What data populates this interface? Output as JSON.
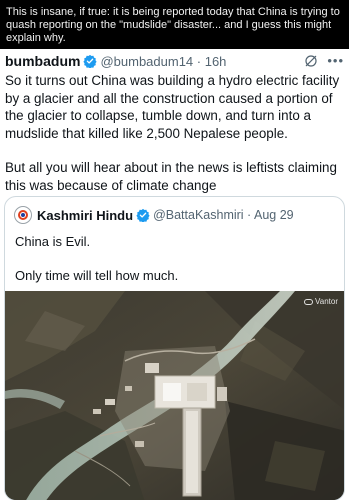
{
  "banner": {
    "text": "This is insane, if true: it is being reported today that China is trying to quash reporting on the \"mudslide\" disaster... and I guess this might explain why."
  },
  "tweet": {
    "author_name": "bumbadum",
    "author_handle": "@bumbadum14",
    "time": "16h",
    "paragraph1": "So it turns out China was building a hydro electric facility by a glacier and all the construction caused a portion of the glacier to collapse, tumble down, and turn into a mudslide that killed like 2,500 Nepalese people.",
    "paragraph2": "But all you will hear about in the news is leftists claiming this was because of climate change",
    "icons": {
      "verified": "verified-badge-icon",
      "grok": "grok-icon",
      "more": "more-icon"
    }
  },
  "quoted": {
    "author_name": "Kashmiri Hindu",
    "author_handle": "@BattaKashmiri",
    "date": "Aug 29",
    "line1": "China is Evil.",
    "line2": "Only time will tell how much.",
    "image_watermark": "Vantor"
  },
  "colors": {
    "banner_bg": "#000000",
    "verified_blue": "#1d9bf0",
    "secondary_text": "#536471"
  }
}
